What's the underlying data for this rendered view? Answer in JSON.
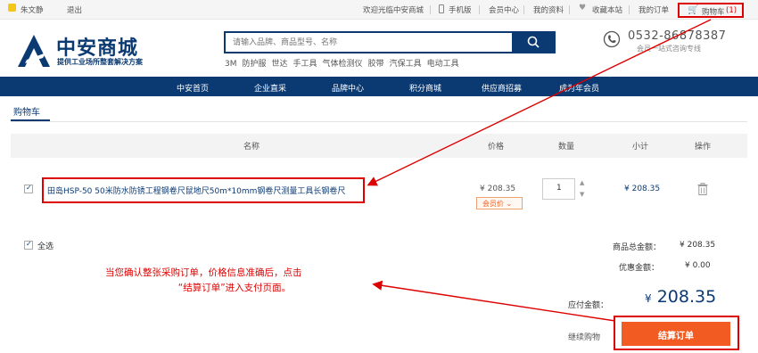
{
  "topbar": {
    "user": "朱文静",
    "logout": "退出",
    "welcome": "欢迎光临中安商城",
    "mobile": "手机版",
    "member_center": "会员中心",
    "my_profile": "我的资料",
    "favorite": "收藏本站",
    "my_orders": "我的订单",
    "cart": "购物车",
    "cart_count": "(1)"
  },
  "header": {
    "logo_title": "中安商城",
    "logo_sub": "提供工业场所整套解决方案",
    "search_placeholder": "请输入品牌、商品型号、名称",
    "hotwords": [
      "3M",
      "防护服",
      "世达",
      "手工具",
      "气体检测仪",
      "胶带",
      "汽保工具",
      "电动工具"
    ],
    "phone": "0532-86878387",
    "phone_sub": "会员一站式咨询专线"
  },
  "nav": [
    "中安首页",
    "企业直采",
    "品牌中心",
    "积分商城",
    "供应商招募",
    "成为年会员"
  ],
  "cart": {
    "tab": "购物车",
    "headers": {
      "name": "名称",
      "price": "价格",
      "qty": "数量",
      "subtotal": "小计",
      "action": "操作"
    },
    "item": {
      "title": "田岛HSP-50 50米防水防锈工程钢卷尺鼠地尺50m*10mm钢卷尺测量工具长钢卷尺",
      "price": "¥ 208.35",
      "badge": "会员价 ",
      "qty": "1",
      "subtotal": "¥ 208.35"
    },
    "select_all": "全选",
    "total_label": "商品总金额：",
    "total_value": "¥ 208.35",
    "discount_label": "优惠金额：",
    "discount_value": "¥ 0.00",
    "payable_label": "应付金额：",
    "payable_currency": "¥",
    "payable_value": "208.35",
    "continue": "继续购物",
    "submit": "结算订单"
  },
  "annotation": {
    "line1": "当您确认整张采购订单，价格信息准确后，点击",
    "line2": "“结算订单”进入支付页面。"
  },
  "colors": {
    "brand": "#0b3a73",
    "accent": "#f25c23",
    "annotation": "#dd0000"
  }
}
